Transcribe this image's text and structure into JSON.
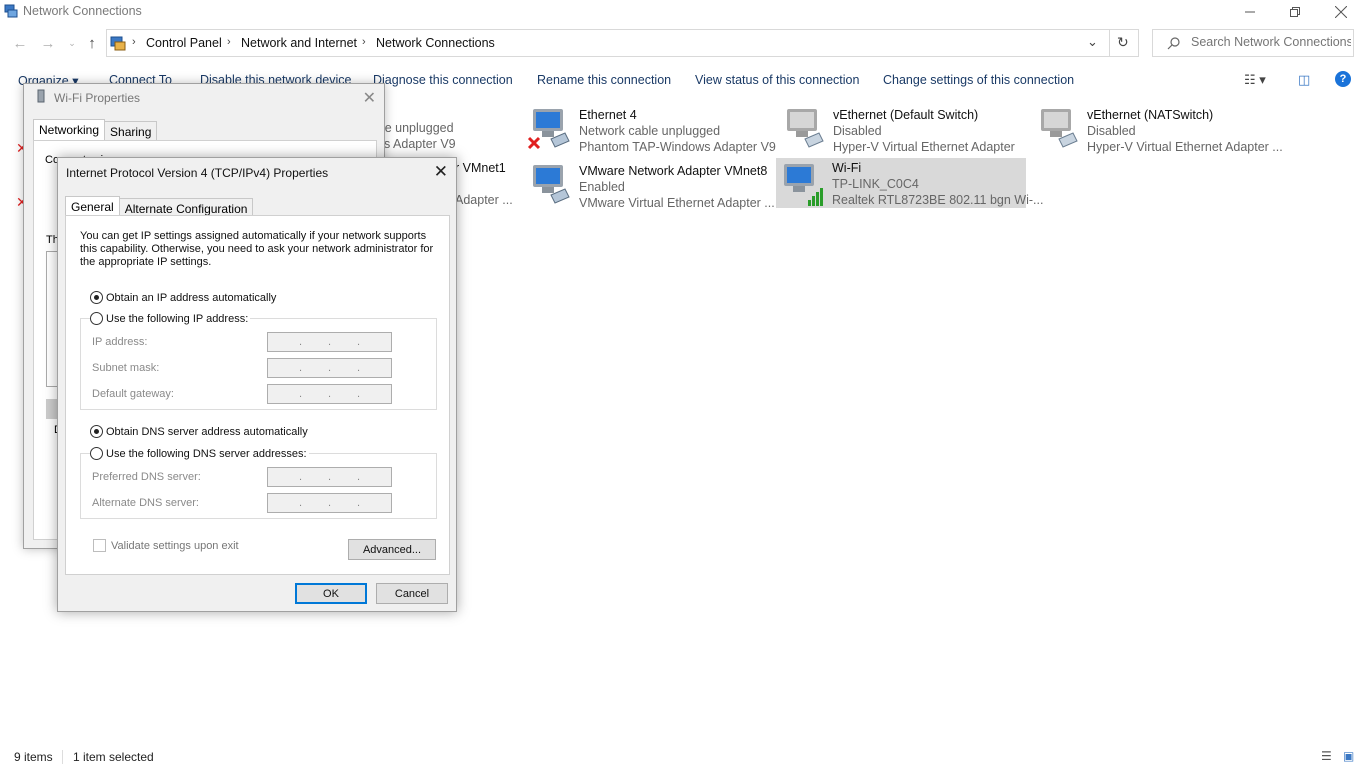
{
  "window": {
    "title": "Network Connections"
  },
  "address": {
    "crumbs": [
      "Control Panel",
      "Network and Internet",
      "Network Connections"
    ]
  },
  "search": {
    "placeholder": "Search Network Connections"
  },
  "commands": {
    "organize": "Organize ▾",
    "connect_to": "Connect To",
    "disable": "Disable this network device",
    "diagnose": "Diagnose this connection",
    "rename": "Rename this connection",
    "view_status": "View status of this connection",
    "change_settings": "Change settings of this connection"
  },
  "connections": [
    {
      "name": "",
      "status": "ble unplugged",
      "device": "ws Adapter V9",
      "disabled_mark": false
    },
    {
      "name": "r VMnet1",
      "status": "",
      "device": "Adapter ...",
      "disabled_mark": false
    },
    {
      "name": "Ethernet 4",
      "status": "Network cable unplugged",
      "device": "Phantom TAP-Windows Adapter V9",
      "disabled_mark": true
    },
    {
      "name": "VMware Network Adapter VMnet8",
      "status": "Enabled",
      "device": "VMware Virtual Ethernet Adapter ..."
    },
    {
      "name": "vEthernet (Default Switch)",
      "status": "Disabled",
      "device": "Hyper-V Virtual Ethernet Adapter"
    },
    {
      "name": "Wi-Fi",
      "status": "TP-LINK_C0C4",
      "device": "Realtek RTL8723BE 802.11 bgn Wi-..."
    },
    {
      "name": "vEthernet (NATSwitch)",
      "status": "Disabled",
      "device": "Hyper-V Virtual Ethernet Adapter ..."
    }
  ],
  "wifi_dialog": {
    "title": "Wi-Fi Properties",
    "tabs": [
      "Networking",
      "Sharing"
    ],
    "connect_using_label": "Connect using:",
    "this_connection_label": "Th",
    "desc_letter": "D"
  },
  "ipv4_dialog": {
    "title": "Internet Protocol Version 4 (TCP/IPv4) Properties",
    "tabs": [
      "General",
      "Alternate Configuration"
    ],
    "description": "You can get IP settings assigned automatically if your network supports this capability. Otherwise, you need to ask your network administrator for the appropriate IP settings.",
    "radio_ip_auto": "Obtain an IP address automatically",
    "radio_ip_manual": "Use the following IP address:",
    "ip_address_label": "IP address:",
    "subnet_mask_label": "Subnet mask:",
    "default_gateway_label": "Default gateway:",
    "radio_dns_auto": "Obtain DNS server address automatically",
    "radio_dns_manual": "Use the following DNS server addresses:",
    "preferred_dns_label": "Preferred DNS server:",
    "alternate_dns_label": "Alternate DNS server:",
    "validate_label": "Validate settings upon exit",
    "advanced_button": "Advanced...",
    "ok_button": "OK",
    "cancel_button": "Cancel"
  },
  "statusbar": {
    "items_count": "9 items",
    "selected_count": "1 item selected"
  },
  "colors": {
    "link": "#1a3a66",
    "selected_bg": "#d9d9d9",
    "accent": "#0078d7"
  }
}
